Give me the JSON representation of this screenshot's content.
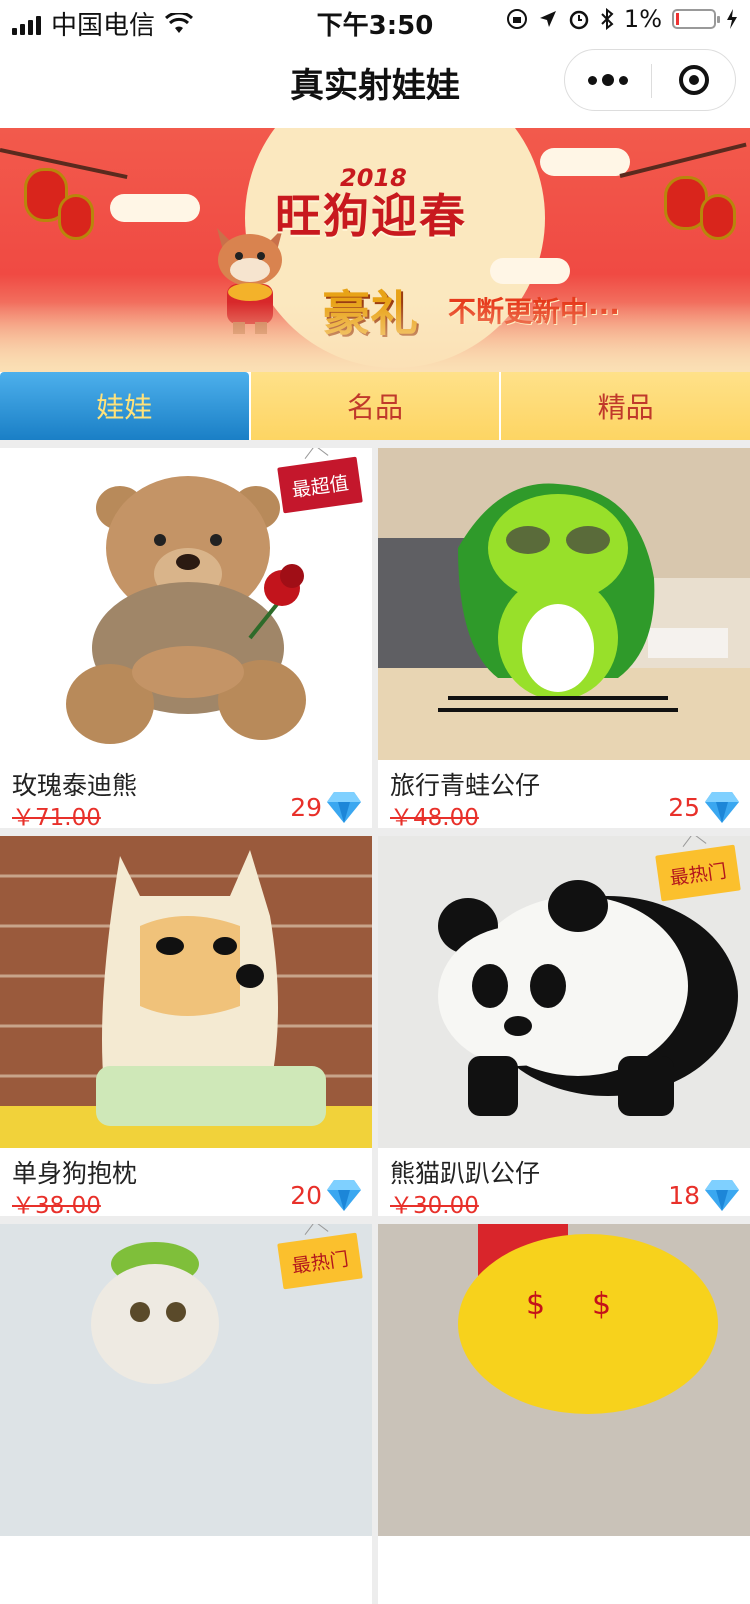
{
  "status_bar": {
    "carrier": "中国电信",
    "time": "下午3:50",
    "battery": "1%"
  },
  "nav": {
    "title": "真实射娃娃"
  },
  "banner": {
    "year": "2018",
    "title": "旺狗迎春",
    "gift": "豪礼",
    "subtitle": "不断更新中···"
  },
  "tabs": [
    {
      "label": "娃娃",
      "active": true
    },
    {
      "label": "名品",
      "active": false
    },
    {
      "label": "精品",
      "active": false
    }
  ],
  "products": [
    {
      "name": "玫瑰泰迪熊",
      "original_price": "￥71.00",
      "price": "29",
      "tag": "最超值"
    },
    {
      "name": "旅行青蛙公仔",
      "original_price": "￥48.00",
      "price": "25",
      "tag": ""
    },
    {
      "name": "单身狗抱枕",
      "original_price": "￥38.00",
      "price": "20",
      "tag": ""
    },
    {
      "name": "熊猫趴趴公仔",
      "original_price": "￥30.00",
      "price": "18",
      "tag": "最热门"
    },
    {
      "name": "",
      "original_price": "",
      "price": "",
      "tag": "最热门"
    },
    {
      "name": "",
      "original_price": "",
      "price": "",
      "tag": ""
    }
  ],
  "colors": {
    "accent_blue": "#1a7fc6",
    "tab_yellow": "#fdd563",
    "price_red": "#e8302a"
  }
}
